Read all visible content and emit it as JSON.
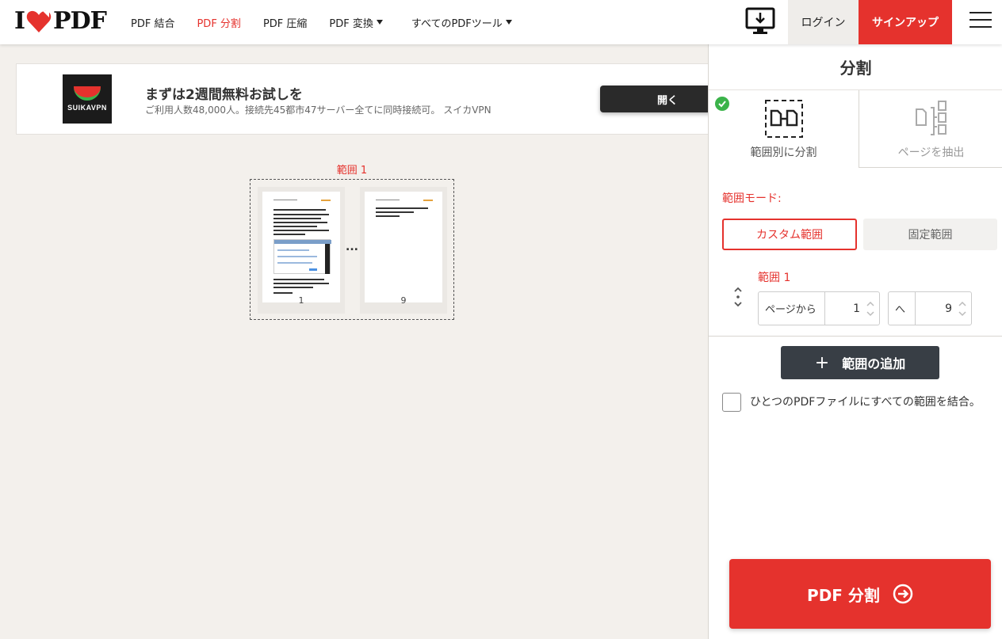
{
  "header": {
    "logo_i": "I",
    "logo_text": "PDF",
    "nav": [
      {
        "label": "PDF 結合",
        "active": false
      },
      {
        "label": "PDF 分割",
        "active": true
      },
      {
        "label": "PDF 圧縮",
        "active": false
      },
      {
        "label": "PDF 変換",
        "active": false,
        "dropdown": true
      },
      {
        "label": "すべてのPDFツール",
        "active": false,
        "dropdown": true
      }
    ],
    "login": "ログイン",
    "signup": "サインアップ"
  },
  "ad": {
    "brand": "SUIKAVPN",
    "title": "まずは2週間無料お試しを",
    "subtitle": "ご利用人数48,000人。接続先45都市47サーバー全てに同時接続可。 スイカVPN",
    "button": "開く"
  },
  "preview": {
    "range_label": "範囲 1",
    "first_page": "1",
    "ellipsis": "...",
    "last_page": "9"
  },
  "sidebar": {
    "title": "分割",
    "tabs": [
      {
        "label": "範囲別に分割",
        "selected": true
      },
      {
        "label": "ページを抽出",
        "selected": false
      }
    ],
    "mode_label": "範囲モード:",
    "mode_custom": "カスタム範囲",
    "mode_fixed": "固定範囲",
    "range_title": "範囲 1",
    "from_label": "ページから",
    "from_value": "1",
    "to_label": "へ",
    "to_value": "9",
    "add_range": "範囲の追加",
    "add_plus": "+",
    "merge_label": "ひとつのPDFファイルにすべての範囲を結合。",
    "split_button": "PDF 分割"
  },
  "colors": {
    "accent": "#e5322d",
    "success": "#3bb34a",
    "dark_button": "#383e45"
  }
}
